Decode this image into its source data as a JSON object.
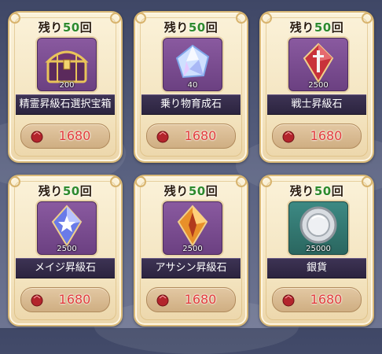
{
  "items": [
    {
      "remaining_prefix": "残り",
      "remaining_count": "50",
      "remaining_suffix": "回",
      "name": "精霊昇級石選択宝箱",
      "quantity": "200",
      "price": "1680",
      "icon": "treasure-chest-icon"
    },
    {
      "remaining_prefix": "残り",
      "remaining_count": "50",
      "remaining_suffix": "回",
      "name": "乗り物育成石",
      "quantity": "40",
      "price": "1680",
      "icon": "crystal-gem-icon"
    },
    {
      "remaining_prefix": "残り",
      "remaining_count": "50",
      "remaining_suffix": "回",
      "name": "戦士昇級石",
      "quantity": "2500",
      "price": "1680",
      "icon": "warrior-stone-icon"
    },
    {
      "remaining_prefix": "残り",
      "remaining_count": "50",
      "remaining_suffix": "回",
      "name": "メイジ昇級石",
      "quantity": "2500",
      "price": "1680",
      "icon": "mage-stone-icon"
    },
    {
      "remaining_prefix": "残り",
      "remaining_count": "50",
      "remaining_suffix": "回",
      "name": "アサシン昇級石",
      "quantity": "2500",
      "price": "1680",
      "icon": "assassin-stone-icon"
    },
    {
      "remaining_prefix": "残り",
      "remaining_count": "50",
      "remaining_suffix": "回",
      "name": "銀貨",
      "quantity": "25000",
      "price": "1680",
      "icon": "silver-coin-icon"
    }
  ],
  "colors": {
    "price_text": "#e23b3b",
    "remaining_count": "#2e8a2c",
    "name_bar": "#2c243f"
  }
}
